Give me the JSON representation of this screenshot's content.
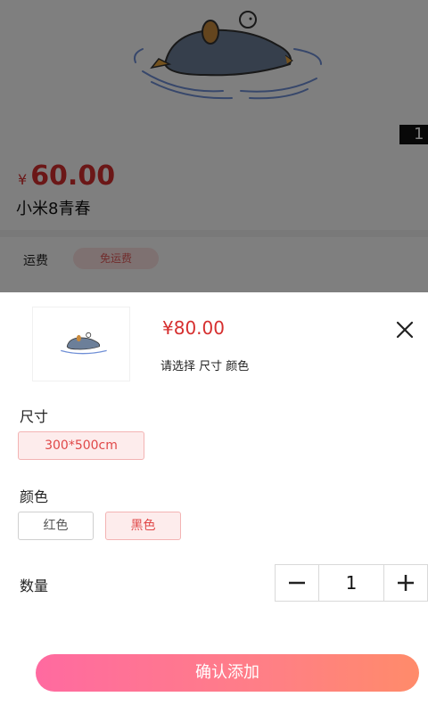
{
  "product": {
    "price_currency": "¥",
    "price_value": "60.00",
    "name": "小米8青春",
    "image_index": "1",
    "shipping_label": "运费",
    "shipping_badge": "免运费"
  },
  "sheet": {
    "price": "¥80.00",
    "hint": "请选择 尺寸 颜色",
    "size_label": "尺寸",
    "sizes": [
      "300*500cm"
    ],
    "color_label": "颜色",
    "colors": [
      "红色",
      "黑色"
    ],
    "quantity_label": "数量",
    "quantity_value": "1",
    "confirm_label": "确认添加"
  },
  "colors": {
    "accent": "#d62f2f",
    "chip_selected_bg": "#fdecec",
    "button_gradient_start": "#ff6aa0",
    "button_gradient_end": "#ff8b6a"
  }
}
